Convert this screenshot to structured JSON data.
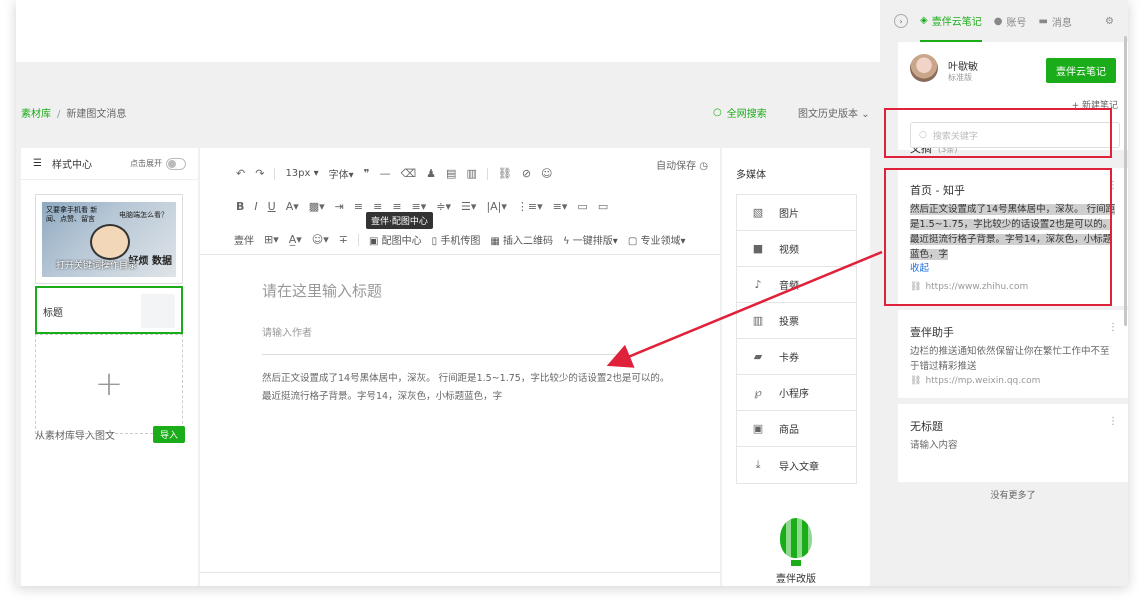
{
  "breadcrumb": {
    "root": "素材库",
    "current": "新建图文消息"
  },
  "search_all": "全网搜索",
  "history": "图文历史版本",
  "style_center": {
    "label": "样式中心",
    "expand": "点击展开"
  },
  "cover": {
    "caption": "打开关键词操作目录",
    "img_text_1": "又要拿手机看 新闻、点赞、留言",
    "img_text_2": "电脑端怎么看？",
    "img_text_3": "好烦 数据"
  },
  "title_card": {
    "label": "标题"
  },
  "import": {
    "label": "从素材库导入图文",
    "button": "导入"
  },
  "toolbar": {
    "autosave": "自动保存",
    "font_size": "13px",
    "font": "字体",
    "tooltip": "壹伴·配图中心",
    "row3": [
      "壹伴",
      "配图中心",
      "手机传图",
      "插入二维码",
      "一键排版",
      "专业领域"
    ]
  },
  "editor": {
    "title_placeholder": "请在这里输入标题",
    "author_placeholder": "请输入作者",
    "body_line1": "然后正文设置成了14号黑体居中，深灰。 行间距是1.5~1.75，字比较少的话设置2也是可以的。",
    "body_line2": "最近挺流行格子背景。字号14，深灰色，小标题蓝色，字"
  },
  "media": {
    "title": "多媒体",
    "items": [
      "图片",
      "视频",
      "音频",
      "投票",
      "卡券",
      "小程序",
      "商品",
      "导入文章"
    ],
    "balloon_label": "壹伴改版"
  },
  "sidebar": {
    "tabs": [
      "壹伴云笔记",
      "账号",
      "消息"
    ],
    "user": {
      "name": "叶歇敏",
      "plan": "标准版",
      "button": "壹伴云笔记"
    },
    "excerpt": {
      "title": "文摘",
      "count": "(3条)",
      "new_note": "+ 新建笔记"
    },
    "search_placeholder": "搜索关键字",
    "notes": [
      {
        "title": "首页 - 知乎",
        "body": "然后正文设置成了14号黑体居中，深灰。 行间距是1.5~1.75，字比较少的话设置2也是可以的。 最近挺流行格子背景。字号14，深灰色，小标题蓝色，字",
        "fold": "收起",
        "url": "https://www.zhihu.com"
      },
      {
        "title": "壹伴助手",
        "body": "边栏的推送通知依然保留让你在繁忙工作中不至于错过精彩推送",
        "url": "https://mp.weixin.qq.com"
      },
      {
        "title": "无标题",
        "body": "请输入内容"
      }
    ],
    "no_more": "没有更多了"
  },
  "colors": {
    "accent": "#1aad19",
    "highlight_border": "#e0213a",
    "arrow": "#e0213a",
    "link": "#1a6fe0"
  }
}
